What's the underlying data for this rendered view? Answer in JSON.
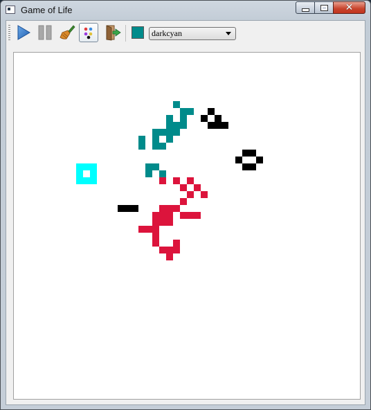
{
  "window": {
    "title": "Game of Life"
  },
  "toolbar": {
    "buttons": [
      "play-icon",
      "pause-icon",
      "clear-broom-icon",
      "color-palette-icon",
      "exit-door-icon"
    ],
    "color_swatch": "#008b8b",
    "color_select": {
      "value": "darkcyan"
    }
  },
  "colors": {
    "darkcyan": "#008b8b",
    "cyan": "#00ffff",
    "black": "#000000",
    "crimson": "#dc143c"
  },
  "board": {
    "cells": {
      "darkcyan": [
        [
          23,
          7
        ],
        [
          24,
          8
        ],
        [
          25,
          8
        ],
        [
          24,
          9
        ],
        [
          22,
          9
        ],
        [
          22,
          10
        ],
        [
          23,
          10
        ],
        [
          24,
          10
        ],
        [
          21,
          11
        ],
        [
          20,
          11
        ],
        [
          22,
          11
        ],
        [
          23,
          11
        ],
        [
          22,
          12
        ],
        [
          20,
          12
        ],
        [
          18,
          12
        ],
        [
          18,
          13
        ],
        [
          20,
          13
        ],
        [
          21,
          13
        ],
        [
          19,
          16
        ],
        [
          20,
          16
        ],
        [
          19,
          17
        ],
        [
          21,
          17
        ]
      ],
      "cyan": [
        [
          9,
          16
        ],
        [
          10,
          16
        ],
        [
          9,
          17
        ],
        [
          11,
          17
        ],
        [
          9,
          18
        ],
        [
          10,
          18
        ],
        [
          11,
          18
        ],
        [
          11,
          16
        ]
      ],
      "black": [
        [
          28,
          8
        ],
        [
          27,
          9
        ],
        [
          29,
          9
        ],
        [
          28,
          10
        ],
        [
          29,
          10
        ],
        [
          30,
          10
        ],
        [
          33,
          14
        ],
        [
          34,
          14
        ],
        [
          32,
          15
        ],
        [
          35,
          15
        ],
        [
          33,
          16
        ],
        [
          34,
          16
        ],
        [
          15,
          22
        ],
        [
          16,
          22
        ],
        [
          17,
          22
        ]
      ],
      "crimson": [
        [
          21,
          18
        ],
        [
          23,
          18
        ],
        [
          25,
          18
        ],
        [
          24,
          19
        ],
        [
          26,
          19
        ],
        [
          25,
          20
        ],
        [
          27,
          20
        ],
        [
          24,
          21
        ],
        [
          21,
          22
        ],
        [
          22,
          22
        ],
        [
          23,
          22
        ],
        [
          20,
          23
        ],
        [
          21,
          23
        ],
        [
          22,
          23
        ],
        [
          24,
          23
        ],
        [
          25,
          23
        ],
        [
          26,
          23
        ],
        [
          20,
          24
        ],
        [
          21,
          24
        ],
        [
          22,
          24
        ],
        [
          18,
          25
        ],
        [
          19,
          25
        ],
        [
          20,
          25
        ],
        [
          20,
          26
        ],
        [
          20,
          27
        ],
        [
          23,
          27
        ],
        [
          21,
          28
        ],
        [
          22,
          28
        ],
        [
          23,
          28
        ],
        [
          22,
          29
        ]
      ]
    }
  }
}
